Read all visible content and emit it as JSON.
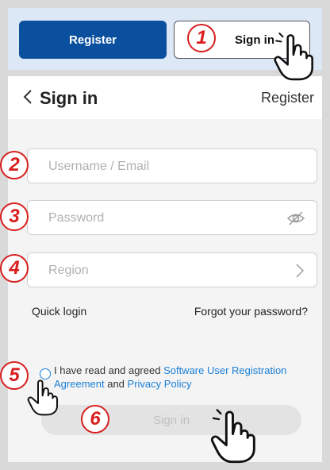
{
  "top": {
    "register_label": "Register",
    "signin_label": "Sign in"
  },
  "header": {
    "back_icon": "chevron-left-icon",
    "title": "Sign in",
    "register_link": "Register"
  },
  "form": {
    "username_placeholder": "Username / Email",
    "password_placeholder": "Password",
    "password_icon": "eye-off-icon",
    "region_placeholder": "Region",
    "region_icon": "chevron-right-icon",
    "quick_login": "Quick login",
    "forgot_password": "Forgot your password?"
  },
  "agreement": {
    "prefix": "I have read and agreed",
    "registration_link": "Software User Registration Agreement",
    "conjunction": "and",
    "privacy_link": "Privacy Policy"
  },
  "signin_button": "Sign in",
  "annotations": {
    "step1": "1",
    "step2": "2",
    "step3": "3",
    "step4": "4",
    "step5": "5",
    "step6": "6"
  },
  "colors": {
    "primary": "#0b4f9f",
    "link": "#1a7fd6",
    "annotation": "#d81e1e",
    "top_panel": "#dde8f6"
  }
}
